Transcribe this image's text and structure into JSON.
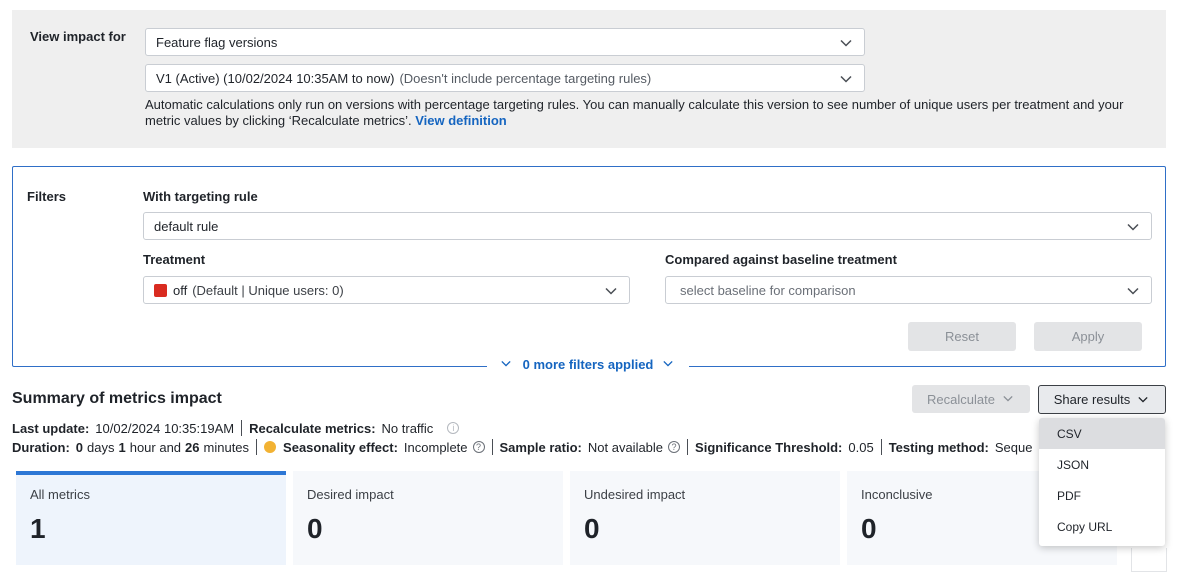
{
  "impact": {
    "label": "View impact for",
    "type_value": "Feature flag versions",
    "version_value": "V1 (Active) (10/02/2024 10:35AM to now)",
    "version_note": "(Doesn't include percentage targeting rules)",
    "note": "Automatic calculations only run on versions with percentage targeting rules. You can manually calculate this version to see number of unique users per treatment and your metric values by clicking ‘Recalculate metrics’.",
    "note_link": "View definition"
  },
  "filters": {
    "label": "Filters",
    "rule_label": "With targeting rule",
    "rule_value": "default rule",
    "treatment_label": "Treatment",
    "treatment_name": "off",
    "treatment_detail": "(Default | Unique users: 0)",
    "treatment_color": "#d92b20",
    "baseline_label": "Compared against baseline treatment",
    "baseline_placeholder": "select baseline for comparison",
    "reset_label": "Reset",
    "apply_label": "Apply",
    "more_filters": "0 more filters applied"
  },
  "summary": {
    "title": "Summary of metrics impact",
    "recalculate_label": "Recalculate",
    "share_label": "Share results",
    "last_update_label": "Last update:",
    "last_update_value": "10/02/2024 10:35:19AM",
    "recalc_metrics_label": "Recalculate metrics:",
    "recalc_metrics_value": "No traffic",
    "duration_label": "Duration:",
    "duration_days": "0",
    "duration_days_unit": "days",
    "duration_hours": "1",
    "duration_hours_unit": "hour and",
    "duration_minutes": "26",
    "duration_minutes_unit": "minutes",
    "seasonality_label": "Seasonality effect:",
    "seasonality_value": "Incomplete",
    "sample_ratio_label": "Sample ratio:",
    "sample_ratio_value": "Not available",
    "significance_label": "Significance Threshold:",
    "significance_value": "0.05",
    "testing_method_label": "Testing method:",
    "testing_method_value": "Seque"
  },
  "cards": [
    {
      "label": "All metrics",
      "value": "1"
    },
    {
      "label": "Desired impact",
      "value": "0"
    },
    {
      "label": "Undesired impact",
      "value": "0"
    },
    {
      "label": "Inconclusive",
      "value": "0"
    }
  ],
  "share_menu": [
    "CSV",
    "JSON",
    "PDF",
    "Copy URL"
  ],
  "colors": {
    "accent": "#2d77d5",
    "link": "#1565c0",
    "warning": "#f2b233"
  }
}
